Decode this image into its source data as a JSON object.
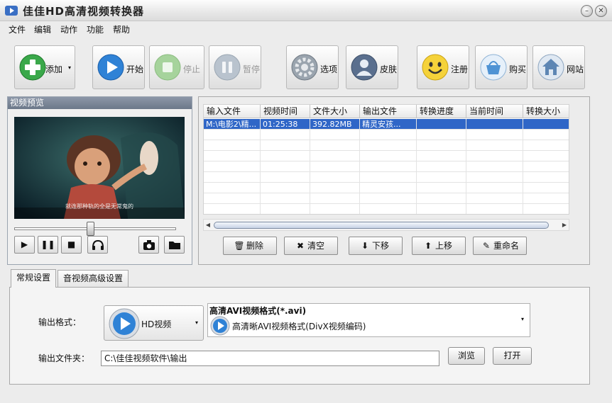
{
  "window": {
    "title": "佳佳HD高清视频转换器"
  },
  "menu": [
    "文件",
    "编辑",
    "动作",
    "功能",
    "帮助"
  ],
  "toolbar": {
    "add": "添加",
    "start": "开始",
    "stop": "停止",
    "pause": "暂停",
    "options": "选项",
    "skin": "皮肤",
    "register": "注册",
    "buy": "购买",
    "website": "网站"
  },
  "preview": {
    "title": "视频预览",
    "subtitle": "就连那种轨的全是无常鬼的",
    "seek_position": 0.47
  },
  "file_table": {
    "columns": [
      "输入文件",
      "视频时间",
      "文件大小",
      "输出文件",
      "转换进度",
      "当前时间",
      "转换大小"
    ],
    "rows": [
      [
        "M:\\电影2\\精...",
        "01:25:38",
        "392.82MB",
        "精灵安孩...",
        "",
        "",
        ""
      ]
    ]
  },
  "list_buttons": {
    "delete": "删除",
    "clear": "清空",
    "down": "下移",
    "up": "上移",
    "rename": "重命名"
  },
  "tabs": [
    "常规设置",
    "音视频高级设置"
  ],
  "settings": {
    "format_label": "输出格式：",
    "format_category": "HD视频",
    "format_title": "高清AVI视频格式(*.avi)",
    "format_desc": "高清晰AVI视频格式(DivX视频编码)",
    "folder_label": "输出文件夹：",
    "folder_value": "C:\\佳佳视频软件\\输出",
    "browse": "浏览",
    "open": "打开"
  },
  "colors": {
    "selection": "#2f66c7",
    "panel_title": "#7a8698",
    "window_bg": "#ececec"
  }
}
